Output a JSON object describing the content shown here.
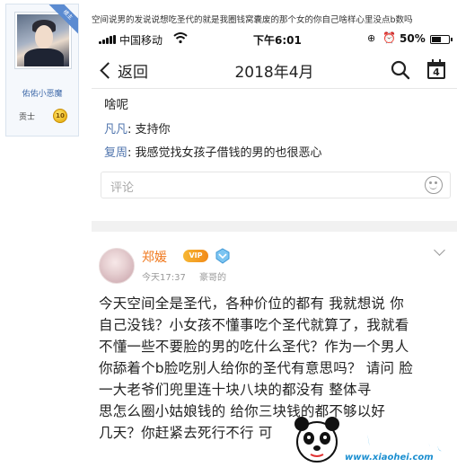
{
  "forum_card": {
    "ribbon_text": "楼主",
    "username": "佑佑小恶魔",
    "rank": "贡士",
    "rank_badge": "10"
  },
  "post_text": "空间说男的发说说想吃圣代的就是我圈钱窝囊废的那个女的你自己啥样心里没点b数吗",
  "status_bar": {
    "carrier": "中国移动",
    "time": "下午6:01",
    "battery_percent": "50%",
    "battery_level": 0.5
  },
  "nav": {
    "back_label": "返回",
    "title": "2018年4月",
    "calendar_number": "4"
  },
  "card_1": {
    "text": "啥呢",
    "comments": [
      {
        "name": "凡凡",
        "text": ": 支持你"
      },
      {
        "name": "复周",
        "text": ": 我感觉找女孩子借钱的男的也很恶心"
      }
    ],
    "comment_placeholder": "评论"
  },
  "card_2": {
    "author": "郑媛",
    "vip_badge": "VIP",
    "time": "今天17:37",
    "source": "豪哥的",
    "body_lines": [
      "今天空间全是圣代，各种价位的都有   我就想说 你",
      "自己没钱？小女孩不懂事吃个圣代就算了，我就看",
      "不懂一些不要脸的男的吃什么圣代？作为一个男人",
      "你舔着个b脸吃别人给你的圣代有意思吗？ 请问 脸",
      "  一大老爷们兜里连十块八块的都没有   整体寻",
      "思怎么圈小姑娘钱的  给你三块钱的都不够以好",
      "几天？你赶紧去死行不行 可"
    ]
  },
  "watermark": {
    "logo": "小黑游戏",
    "url": "www.xiaohei.com"
  },
  "colors": {
    "link_blue": "#4f74ad",
    "name_orange": "#f07a20",
    "watermark_blue": "#1fa3e8"
  }
}
